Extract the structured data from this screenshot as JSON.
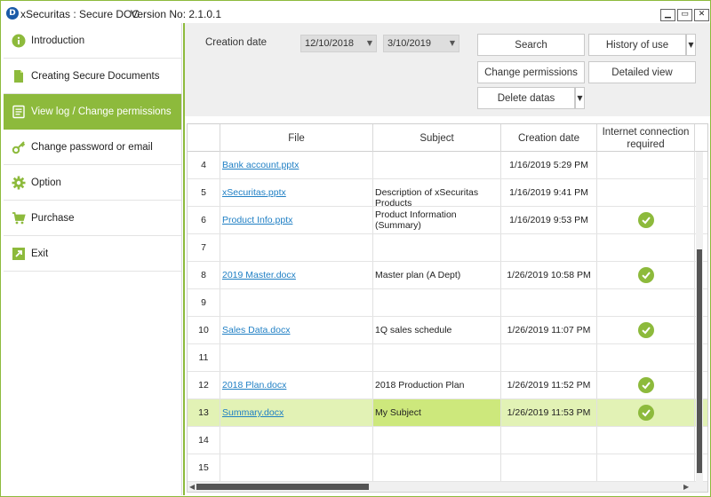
{
  "titlebar": {
    "logo_letter": "D",
    "title": "xSecuritas : Secure DOC",
    "version": "Version No: 2.1.0.1",
    "minimize_glyph": "▁",
    "maximize_glyph": "▭",
    "close_glyph": "✕"
  },
  "sidebar": {
    "items": [
      {
        "label": "Introduction",
        "icon": "info-icon",
        "active": false
      },
      {
        "label": "Creating Secure Documents",
        "icon": "document-icon",
        "active": false
      },
      {
        "label": "View log / Change permissions",
        "icon": "log-icon",
        "active": true
      },
      {
        "label": "Change password or email",
        "icon": "key-icon",
        "active": false
      },
      {
        "label": "Option",
        "icon": "gear-icon",
        "active": false
      },
      {
        "label": "Purchase",
        "icon": "cart-icon",
        "active": false
      },
      {
        "label": "Exit",
        "icon": "exit-icon",
        "active": false
      }
    ]
  },
  "filter": {
    "creation_date_label": "Creation date",
    "date_from": "12/10/2018",
    "date_to": "3/10/2019",
    "search_label": "Search",
    "history_label": "History of use",
    "change_permissions_label": "Change permissions",
    "detailed_view_label": "Detailed view",
    "delete_label": "Delete datas"
  },
  "table": {
    "headers": {
      "file": "File",
      "subject": "Subject",
      "creation_date": "Creation date",
      "internet": "Internet connection required"
    },
    "rows": [
      {
        "num": "4",
        "file": "Bank account.pptx",
        "subject": "",
        "date": "1/16/2019 5:29 PM",
        "internet": false,
        "selected": false
      },
      {
        "num": "5",
        "file": "xSecuritas.pptx",
        "subject": "Description of xSecuritas Products",
        "date": "1/16/2019 9:41 PM",
        "internet": false,
        "selected": false
      },
      {
        "num": "6",
        "file": "Product Info.pptx",
        "subject": "Product Information (Summary)",
        "date": "1/16/2019 9:53 PM",
        "internet": true,
        "selected": false
      },
      {
        "num": "7",
        "file": "",
        "subject": "",
        "date": "",
        "internet": false,
        "selected": false
      },
      {
        "num": "8",
        "file": "2019 Master.docx",
        "subject": "Master plan (A Dept)",
        "date": "1/26/2019 10:58 PM",
        "internet": true,
        "selected": false
      },
      {
        "num": "9",
        "file": "",
        "subject": "",
        "date": "",
        "internet": false,
        "selected": false
      },
      {
        "num": "10",
        "file": "Sales Data.docx",
        "subject": "1Q sales schedule",
        "date": "1/26/2019 11:07 PM",
        "internet": true,
        "selected": false
      },
      {
        "num": "11",
        "file": "",
        "subject": "",
        "date": "",
        "internet": false,
        "selected": false
      },
      {
        "num": "12",
        "file": "2018 Plan.docx",
        "subject": "2018 Production Plan",
        "date": "1/26/2019 11:52 PM",
        "internet": true,
        "selected": false
      },
      {
        "num": "13",
        "file": "Summary.docx",
        "subject": "My Subject",
        "date": "1/26/2019 11:53 PM",
        "internet": true,
        "selected": true
      },
      {
        "num": "14",
        "file": "",
        "subject": "",
        "date": "",
        "internet": false,
        "selected": false
      },
      {
        "num": "15",
        "file": "",
        "subject": "",
        "date": "",
        "internet": false,
        "selected": false
      }
    ]
  },
  "colors": {
    "accent": "#8dba3c",
    "link": "#1f7fc4",
    "selected_row": "#e2f2b5"
  }
}
